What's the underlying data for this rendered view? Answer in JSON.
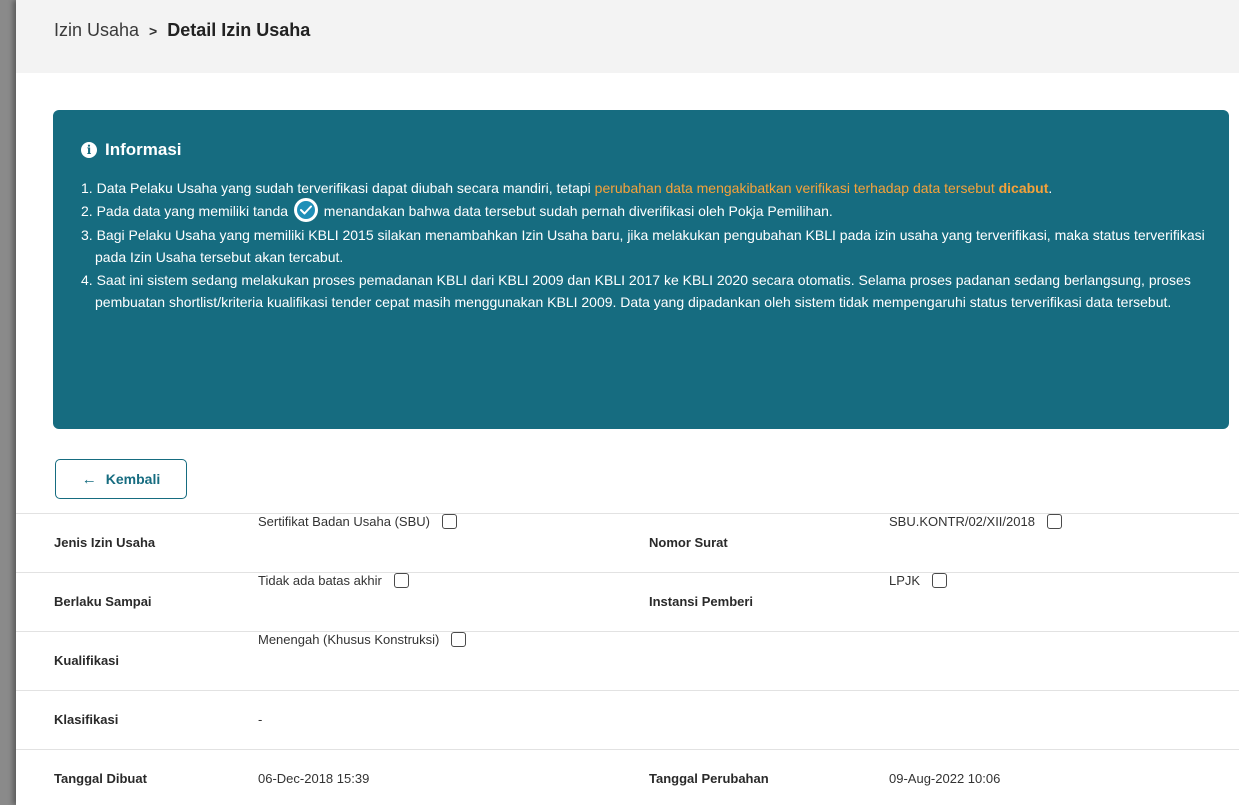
{
  "breadcrumb": {
    "parent": "Izin Usaha",
    "separator": ">",
    "current": "Detail Izin Usaha"
  },
  "info": {
    "icon": "info-circle-icon",
    "title": "Informasi",
    "item1": {
      "num": "1.",
      "text_a": "Data Pelaku Usaha yang sudah terverifikasi dapat diubah secara mandiri, tetapi ",
      "highlight": "perubahan data mengakibatkan verifikasi terhadap data tersebut ",
      "highlight_bold": "dicabut",
      "end": "."
    },
    "item2": {
      "num": "2.",
      "text_a": "Pada data yang memiliki tanda ",
      "icon": "verified-check-icon",
      "text_b": " menandakan bahwa data tersebut sudah pernah diverifikasi oleh Pokja Pemilihan."
    },
    "item3": {
      "num": "3.",
      "text": "Bagi Pelaku Usaha yang memiliki KBLI 2015 silakan menambahkan Izin Usaha baru, jika melakukan pengubahan KBLI pada izin usaha yang terverifikasi, maka status terverifikasi pada Izin Usaha tersebut akan tercabut."
    },
    "item4": {
      "num": "4.",
      "text": "Saat ini sistem sedang melakukan proses pemadanan KBLI dari KBLI 2009 dan KBLI 2017 ke KBLI 2020 secara otomatis. Selama proses padanan sedang berlangsung, proses pembuatan shortlist/kriteria kualifikasi tender cepat masih menggunakan KBLI 2009. Data yang dipadankan oleh sistem tidak mempengaruhi status terverifikasi data tersebut."
    }
  },
  "back_button": {
    "label": "Kembali",
    "icon": "arrow-left-icon"
  },
  "details": {
    "jenis_izin": {
      "label": "Jenis Izin Usaha",
      "value": "Sertifikat Badan Usaha (SBU)"
    },
    "nomor_surat": {
      "label": "Nomor Surat",
      "value": "SBU.KONTR/02/XII/2018"
    },
    "berlaku": {
      "label": "Berlaku Sampai",
      "value": "Tidak ada batas akhir"
    },
    "instansi": {
      "label": "Instansi Pemberi",
      "value": "LPJK"
    },
    "kualifikasi": {
      "label": "Kualifikasi",
      "value": "Menengah (Khusus Konstruksi)"
    },
    "klasifikasi": {
      "label": "Klasifikasi",
      "value": "-"
    },
    "tanggal_dibuat": {
      "label": "Tanggal Dibuat",
      "value": "06-Dec-2018 15:39"
    },
    "tanggal_perubahan": {
      "label": "Tanggal Perubahan",
      "value": "09-Aug-2022 10:06"
    }
  },
  "colors": {
    "info_bg": "#166c80",
    "highlight": "#f6a23a",
    "verified": "#1f8fb8"
  }
}
